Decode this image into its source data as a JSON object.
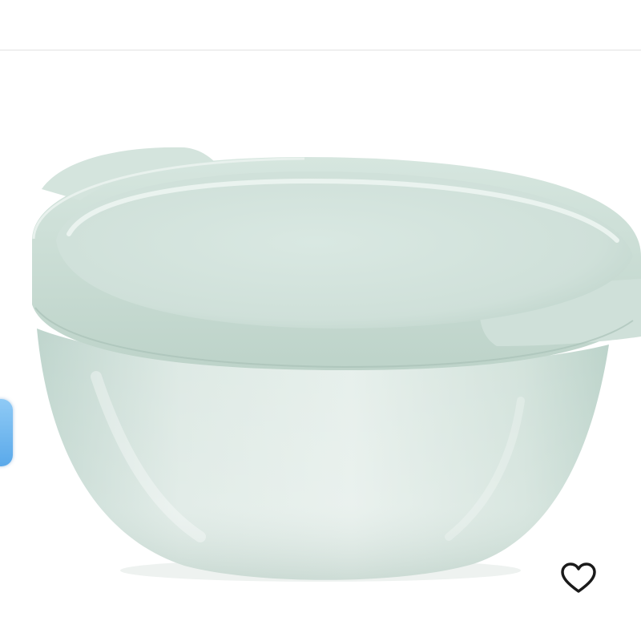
{
  "colors": {
    "bowl_base": "#d3e3dd",
    "bowl_rim": "#c9ddd5",
    "bowl_shadow": "#a9c2b8",
    "side_tab": "#6bb4ef",
    "heart_stroke": "#1a1a1a"
  },
  "icons": {
    "wishlist": "heart-outline-icon"
  },
  "product_image": {
    "subject": "basin"
  }
}
